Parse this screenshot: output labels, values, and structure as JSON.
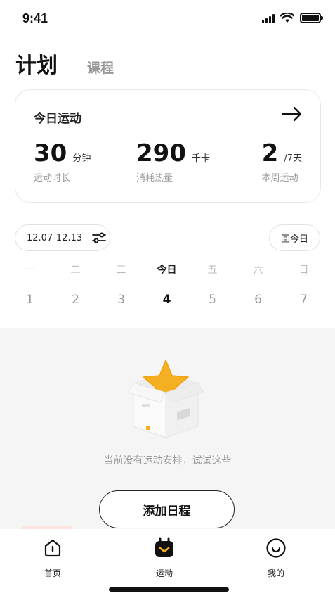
{
  "status_bar": {
    "time": "9:41"
  },
  "header": {
    "tabs": [
      {
        "label": "计划",
        "active": true
      },
      {
        "label": "课程",
        "active": false
      }
    ]
  },
  "today_card": {
    "title": "今日运动",
    "arrow_icon": "arrow-right-icon",
    "stats": [
      {
        "value": "30",
        "unit": "分钟",
        "label": "运动时长"
      },
      {
        "value": "290",
        "unit": "千卡",
        "label": "消耗热量"
      },
      {
        "value": "2",
        "unit": "/7天",
        "label": "本周运动"
      }
    ]
  },
  "controls": {
    "date_range": "12.07-12.13",
    "filter_icon": "sliders-icon",
    "today_button": "回今日"
  },
  "week": [
    {
      "name": "一",
      "num": "1",
      "active": false
    },
    {
      "name": "二",
      "num": "2",
      "active": false
    },
    {
      "name": "三",
      "num": "3",
      "active": false
    },
    {
      "name": "今日",
      "num": "4",
      "active": true
    },
    {
      "name": "五",
      "num": "5",
      "active": false
    },
    {
      "name": "六",
      "num": "6",
      "active": false
    },
    {
      "name": "日",
      "num": "7",
      "active": false
    }
  ],
  "empty_state": {
    "illustration": "star-box-icon",
    "message": "当前没有运动安排，试试这些",
    "add_button": "添加日程"
  },
  "bottom_nav": [
    {
      "label": "首页",
      "icon": "home-icon",
      "active": false
    },
    {
      "label": "运动",
      "icon": "calendar-icon",
      "active": true
    },
    {
      "label": "我的",
      "icon": "smile-icon",
      "active": false
    }
  ],
  "colors": {
    "text_primary": "#111111",
    "text_secondary": "#999999",
    "empty_bg": "#f5f5f5",
    "star": "#f5b021"
  }
}
